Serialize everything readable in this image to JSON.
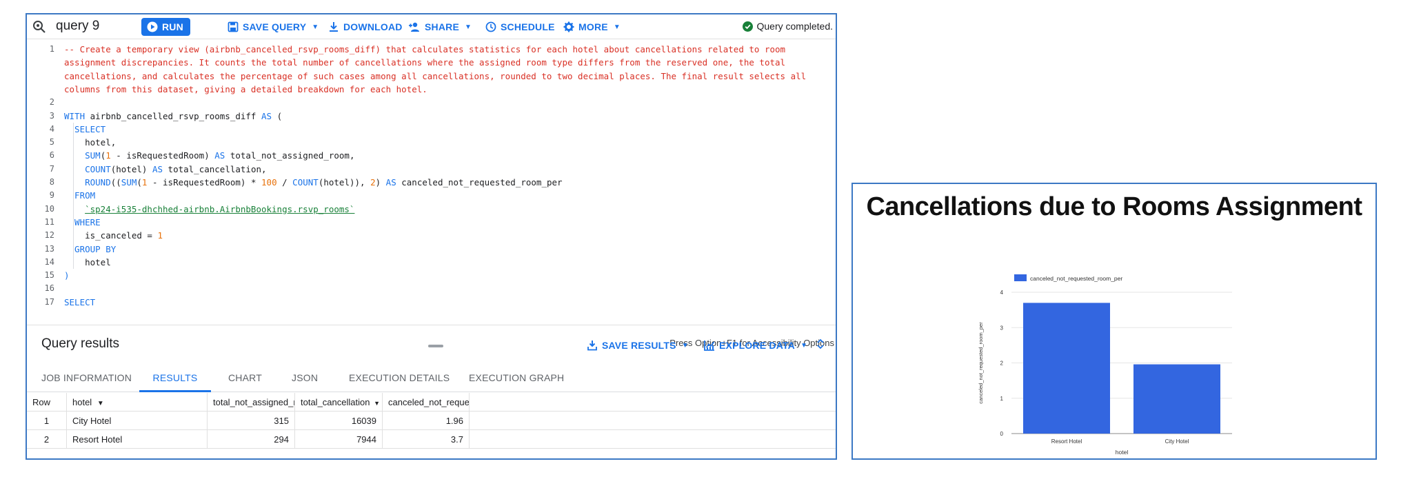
{
  "toolbar": {
    "title": "query 9",
    "run": "RUN",
    "save_query": "SAVE QUERY",
    "download": "DOWNLOAD",
    "share": "SHARE",
    "schedule": "SCHEDULE",
    "more": "MORE",
    "status": "Query completed."
  },
  "editor": {
    "lines": [
      {
        "n": "1",
        "parts": [
          {
            "t": "cmt",
            "v": "-- Create a temporary view (airbnb_cancelled_rsvp_rooms_diff) that calculates statistics for each hotel about cancellations related to room"
          }
        ]
      },
      {
        "n": "",
        "parts": [
          {
            "t": "cmt",
            "v": "assignment discrepancies. It counts the total number of cancellations where the assigned room type differs from the reserved one, the total"
          }
        ]
      },
      {
        "n": "",
        "parts": [
          {
            "t": "cmt",
            "v": "cancellations, and calculates the percentage of such cases among all cancellations, rounded to two decimal places. The final result selects all"
          }
        ]
      },
      {
        "n": "",
        "parts": [
          {
            "t": "cmt",
            "v": "columns from this dataset, giving a detailed breakdown for each hotel."
          }
        ]
      },
      {
        "n": "2",
        "parts": []
      },
      {
        "n": "3",
        "parts": [
          {
            "t": "kw",
            "v": "WITH"
          },
          {
            "t": "",
            "v": " airbnb_cancelled_rsvp_rooms_diff "
          },
          {
            "t": "kw",
            "v": "AS"
          },
          {
            "t": "",
            "v": " ("
          }
        ]
      },
      {
        "n": "4",
        "parts": [
          {
            "t": "kw",
            "v": "  SELECT"
          }
        ]
      },
      {
        "n": "5",
        "parts": [
          {
            "t": "",
            "v": "    hotel,"
          }
        ]
      },
      {
        "n": "6",
        "parts": [
          {
            "t": "kw",
            "v": "    SUM"
          },
          {
            "t": "",
            "v": "("
          },
          {
            "t": "num",
            "v": "1"
          },
          {
            "t": "",
            "v": " - isRequestedRoom) "
          },
          {
            "t": "kw",
            "v": "AS"
          },
          {
            "t": "",
            "v": " total_not_assigned_room,"
          }
        ]
      },
      {
        "n": "7",
        "parts": [
          {
            "t": "kw",
            "v": "    COUNT"
          },
          {
            "t": "",
            "v": "(hotel) "
          },
          {
            "t": "kw",
            "v": "AS"
          },
          {
            "t": "",
            "v": " total_cancellation,"
          }
        ]
      },
      {
        "n": "8",
        "parts": [
          {
            "t": "kw",
            "v": "    ROUND"
          },
          {
            "t": "",
            "v": "(("
          },
          {
            "t": "kw",
            "v": "SUM"
          },
          {
            "t": "",
            "v": "("
          },
          {
            "t": "num",
            "v": "1"
          },
          {
            "t": "",
            "v": " - isRequestedRoom) * "
          },
          {
            "t": "num",
            "v": "100"
          },
          {
            "t": "",
            "v": " / "
          },
          {
            "t": "kw",
            "v": "COUNT"
          },
          {
            "t": "",
            "v": "(hotel)), "
          },
          {
            "t": "num",
            "v": "2"
          },
          {
            "t": "",
            "v": ") "
          },
          {
            "t": "kw",
            "v": "AS"
          },
          {
            "t": "",
            "v": " canceled_not_requested_room_per"
          }
        ]
      },
      {
        "n": "9",
        "parts": [
          {
            "t": "kw",
            "v": "  FROM"
          }
        ]
      },
      {
        "n": "10",
        "parts": [
          {
            "t": "",
            "v": "    "
          },
          {
            "t": "str",
            "v": "`sp24-i535-dhchhed-airbnb.AirbnbBookings.rsvp_rooms`"
          }
        ]
      },
      {
        "n": "11",
        "parts": [
          {
            "t": "kw",
            "v": "  WHERE"
          }
        ]
      },
      {
        "n": "12",
        "parts": [
          {
            "t": "",
            "v": "    is_canceled = "
          },
          {
            "t": "num",
            "v": "1"
          }
        ]
      },
      {
        "n": "13",
        "parts": [
          {
            "t": "kw",
            "v": "  GROUP BY"
          }
        ]
      },
      {
        "n": "14",
        "parts": [
          {
            "t": "",
            "v": "    hotel"
          }
        ]
      },
      {
        "n": "15",
        "parts": [
          {
            "t": "kw",
            "v": ")"
          }
        ]
      },
      {
        "n": "16",
        "parts": []
      },
      {
        "n": "17",
        "parts": [
          {
            "t": "kw",
            "v": "SELECT"
          }
        ]
      }
    ],
    "accessibility_note": "Press Option+F1 for Accessibility Options"
  },
  "results": {
    "title": "Query results",
    "save_results": "SAVE RESULTS",
    "explore_data": "EXPLORE DATA",
    "tabs": [
      "JOB INFORMATION",
      "RESULTS",
      "CHART",
      "JSON",
      "EXECUTION DETAILS",
      "EXECUTION GRAPH"
    ],
    "active_tab": "RESULTS",
    "columns": [
      "Row",
      "hotel",
      "total_not_assigned_r",
      "total_cancellation",
      "canceled_not_reques"
    ],
    "rows": [
      [
        "1",
        "City Hotel",
        "315",
        "16039",
        "1.96"
      ],
      [
        "2",
        "Resort Hotel",
        "294",
        "7944",
        "3.7"
      ]
    ]
  },
  "chart_data": {
    "type": "bar",
    "title": "Cancellations due to Rooms Assignment",
    "categories": [
      "Resort Hotel",
      "City Hotel"
    ],
    "series": [
      {
        "name": "canceled_not_requested_room_per",
        "values": [
          3.7,
          1.96
        ]
      }
    ],
    "xlabel": "hotel",
    "ylabel": "canceled_not_requested_room_per",
    "yticks": [
      "0",
      "1",
      "2",
      "3",
      "4"
    ],
    "ylim": [
      0,
      4
    ],
    "grid": true,
    "legend": "top-left",
    "bar_color": "#3366e0"
  }
}
